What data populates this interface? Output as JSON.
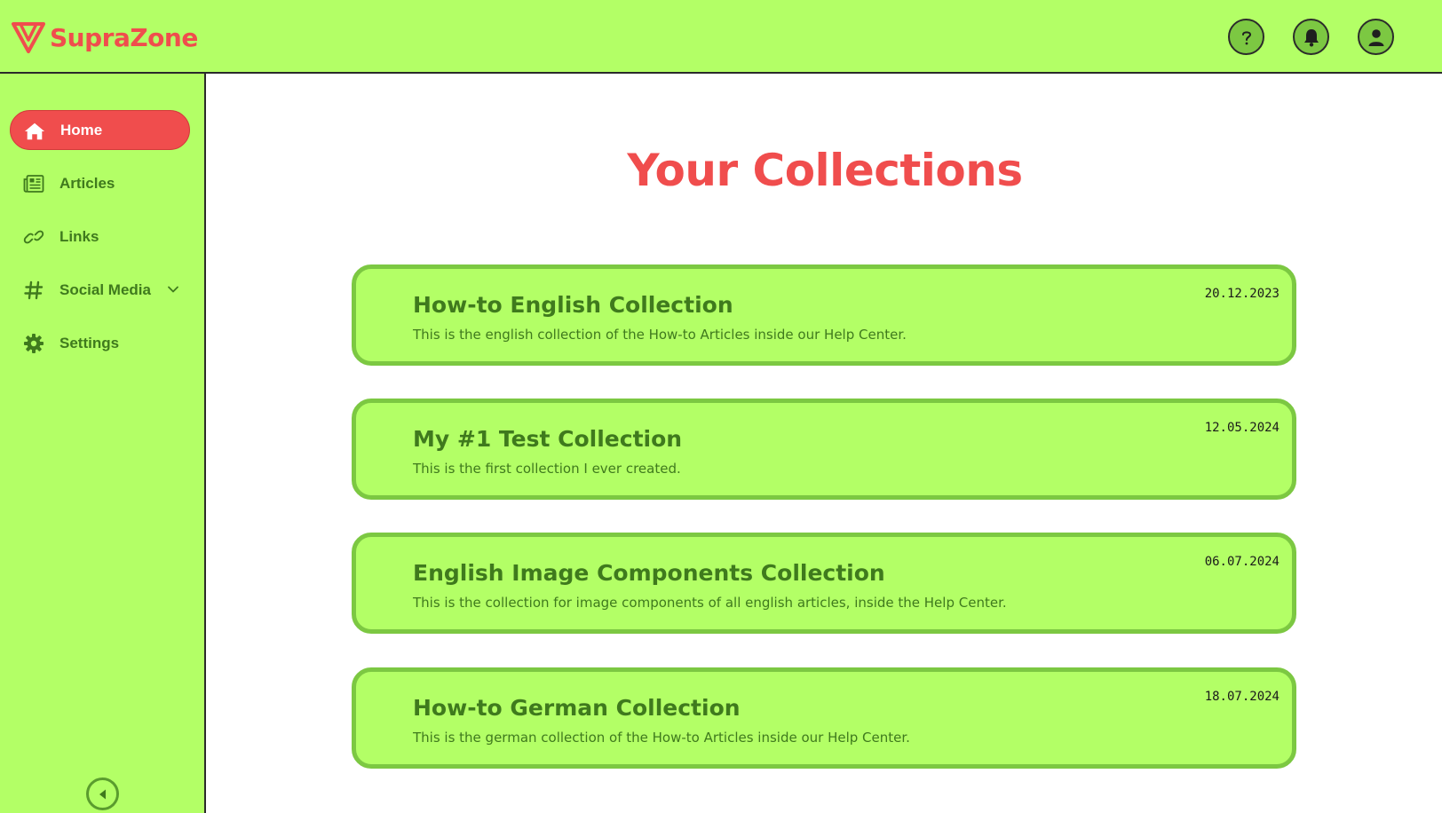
{
  "app": {
    "brand_name": "SupraZone",
    "accent_color": "#f04d4d",
    "background_color": "#b3ff66",
    "border_green": "#7cc842",
    "text_green": "#3f7a1d"
  },
  "topbar": {
    "icons": [
      "help-icon",
      "bell-icon",
      "user-icon"
    ]
  },
  "sidebar": {
    "items": [
      {
        "label": "Home",
        "icon": "home-icon",
        "active": true
      },
      {
        "label": "Articles",
        "icon": "newspaper-icon",
        "active": false
      },
      {
        "label": "Links",
        "icon": "link-icon",
        "active": false
      },
      {
        "label": "Social Media",
        "icon": "hashtag-icon",
        "active": false,
        "has_dropdown": true
      },
      {
        "label": "Settings",
        "icon": "gear-icon",
        "active": false
      }
    ],
    "collapse_icon": "collapse-left-icon"
  },
  "main": {
    "title": "Your Collections",
    "collections": [
      {
        "title": "How-to English Collection",
        "description": "This is the english collection of the How-to Articles inside our Help Center.",
        "date": "20.12.2023"
      },
      {
        "title": "My #1 Test Collection",
        "description": "This is the first collection I ever created.",
        "date": "12.05.2024"
      },
      {
        "title": "English Image Components Collection",
        "description": "This is the collection for image components of all english articles, inside the Help Center.",
        "date": "06.07.2024"
      },
      {
        "title": "How-to German Collection",
        "description": "This is the german collection of the How-to Articles inside our Help Center.",
        "date": "18.07.2024"
      }
    ]
  }
}
